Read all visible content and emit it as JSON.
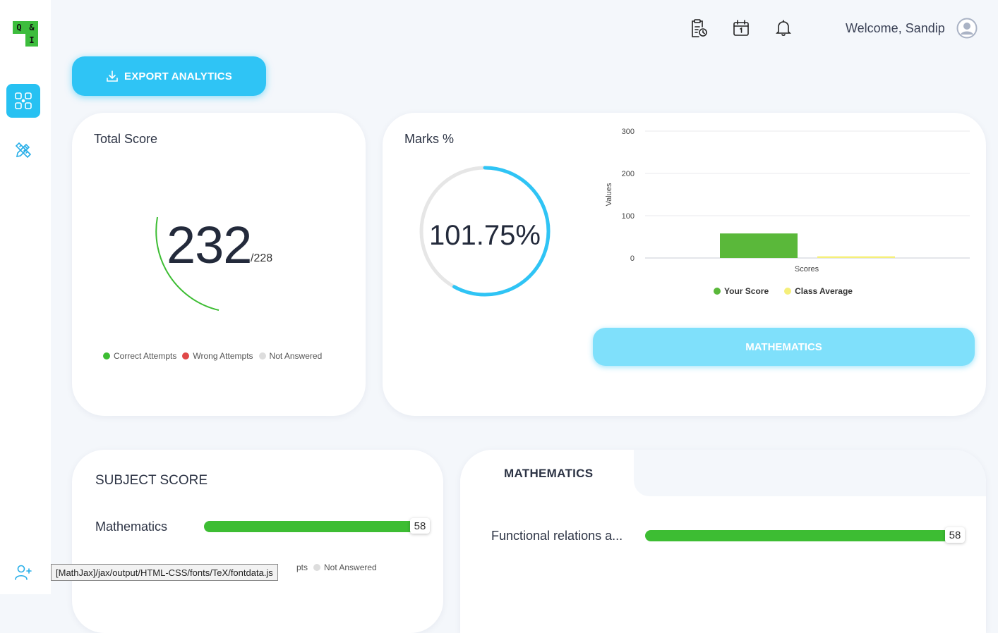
{
  "logo": {
    "letters": [
      "Q",
      "&",
      "",
      "I"
    ]
  },
  "header": {
    "welcome": "Welcome, Sandip",
    "icons": [
      "report-clock-icon",
      "calendar-icon",
      "bell-icon",
      "user-avatar-icon"
    ]
  },
  "sidebar": {
    "items": [
      {
        "name": "dashboard",
        "icon": "grid-icon",
        "active": true
      },
      {
        "name": "tools",
        "icon": "pencil-ruler-icon",
        "active": false
      },
      {
        "name": "add-user",
        "icon": "add-user-icon",
        "active": false
      }
    ]
  },
  "export_button": {
    "label": "EXPORT ANALYTICS",
    "icon": "download-icon"
  },
  "total_score": {
    "title": "Total Score",
    "value": "232",
    "total": "/228",
    "legend": [
      {
        "label": "Correct Attempts",
        "color": "#3dbd33"
      },
      {
        "label": "Wrong Attempts",
        "color": "#e04848"
      },
      {
        "label": "Not Answered",
        "color": "#dddddd"
      }
    ]
  },
  "marks": {
    "title": "Marks %",
    "percent_text": "101.75%",
    "ring_fraction": 0.58,
    "ring_color": "#2fc4f5"
  },
  "chart_data": {
    "type": "bar",
    "categories": [
      "Scores"
    ],
    "series": [
      {
        "name": "Your Score",
        "values": [
          58
        ],
        "color": "#5ab83a"
      },
      {
        "name": "Class Average",
        "values": [
          4
        ],
        "color": "#f5ef7a"
      }
    ],
    "xlabel": "Scores",
    "ylabel": "Values",
    "ylim": [
      0,
      300
    ],
    "yticks": [
      0,
      100,
      200,
      300
    ],
    "grid": true,
    "legend_position": "bottom"
  },
  "subject_button": {
    "label": "MATHEMATICS"
  },
  "subject_score": {
    "title": "SUBJECT SCORE",
    "rows": [
      {
        "label": "Mathematics",
        "value": "58"
      }
    ],
    "legend_partial": "pts",
    "legend_not_answered": "Not Answered"
  },
  "topic_panel": {
    "tab": "MATHEMATICS",
    "rows": [
      {
        "label": "Functional relations a...",
        "value": "58"
      }
    ]
  },
  "tooltip": "[MathJax]/jax/output/HTML-CSS/fonts/TeX/fontdata.js"
}
